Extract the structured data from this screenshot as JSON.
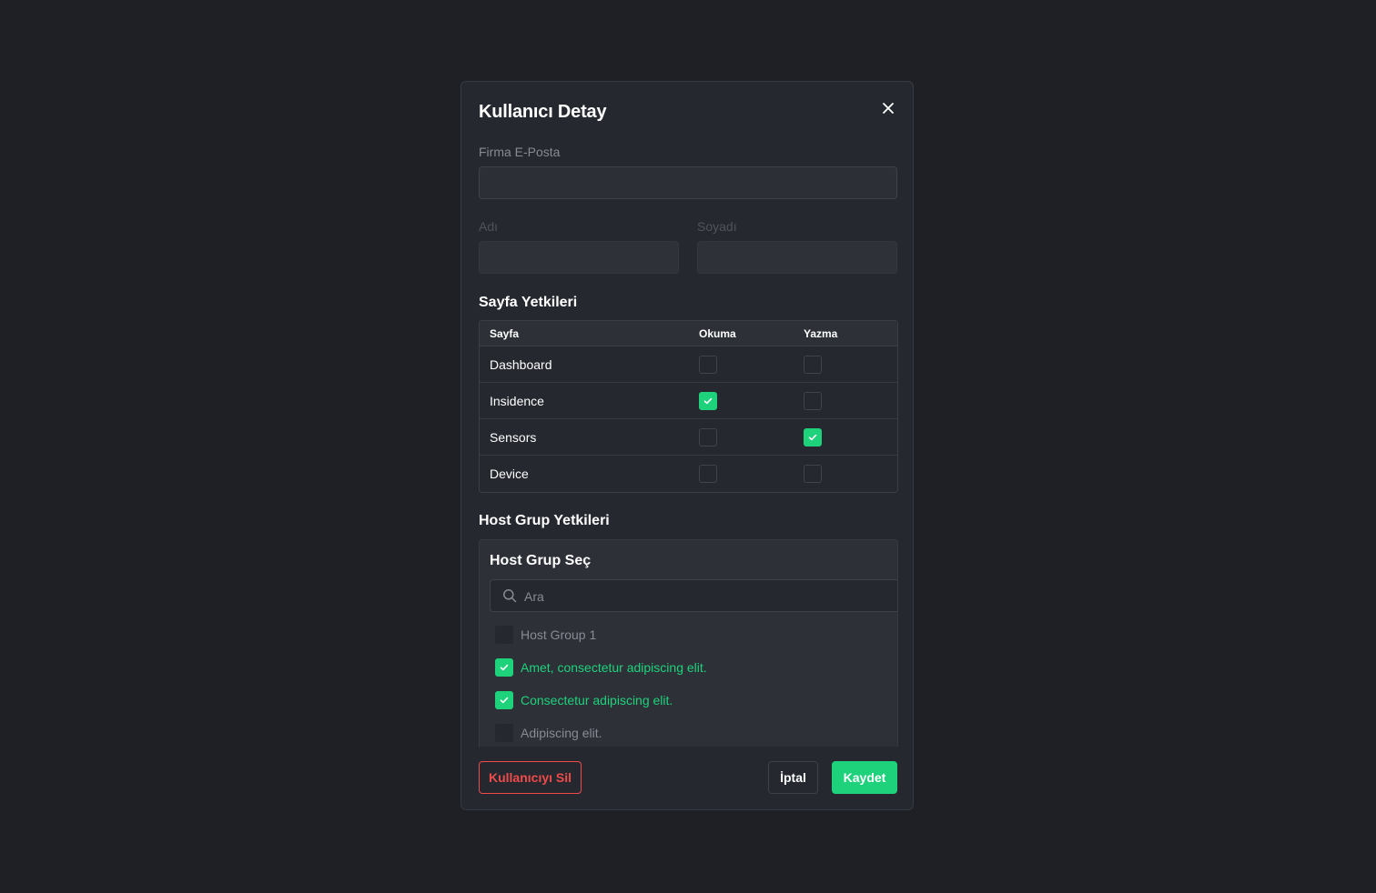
{
  "modal": {
    "title": "Kullanıcı Detay"
  },
  "form": {
    "email_label": "Firma E-Posta",
    "email_value": "",
    "first_name_label": "Adı",
    "first_name_value": "",
    "last_name_label": "Soyadı",
    "last_name_value": ""
  },
  "page_permissions": {
    "title": "Sayfa Yetkileri",
    "columns": [
      "Sayfa",
      "Okuma",
      "Yazma"
    ],
    "rows": [
      {
        "page": "Dashboard",
        "read": false,
        "write": false
      },
      {
        "page": "Insidence",
        "read": true,
        "write": false
      },
      {
        "page": "Sensors",
        "read": false,
        "write": true
      },
      {
        "page": "Device",
        "read": false,
        "write": false
      }
    ]
  },
  "host_group_permissions": {
    "title": "Host Grup Yetkileri",
    "panel_title": "Host Grup Seç",
    "search_placeholder": "Ara",
    "items": [
      {
        "label": "Host Group 1",
        "checked": false
      },
      {
        "label": "Amet, consectetur adipiscing elit.",
        "checked": true
      },
      {
        "label": "Consectetur adipiscing elit.",
        "checked": true
      },
      {
        "label": "Adipiscing elit.",
        "checked": false
      }
    ]
  },
  "actions": {
    "delete_label": "Kullanıcıyı Sil",
    "cancel_label": "İptal",
    "save_label": "Kaydet"
  },
  "colors": {
    "background": "#1e2026",
    "modal": "#25282e",
    "accent": "#1ed27c",
    "danger": "#ef4b4b"
  },
  "icons": {
    "close": "close-icon",
    "search": "search-icon",
    "check": "check-icon"
  }
}
